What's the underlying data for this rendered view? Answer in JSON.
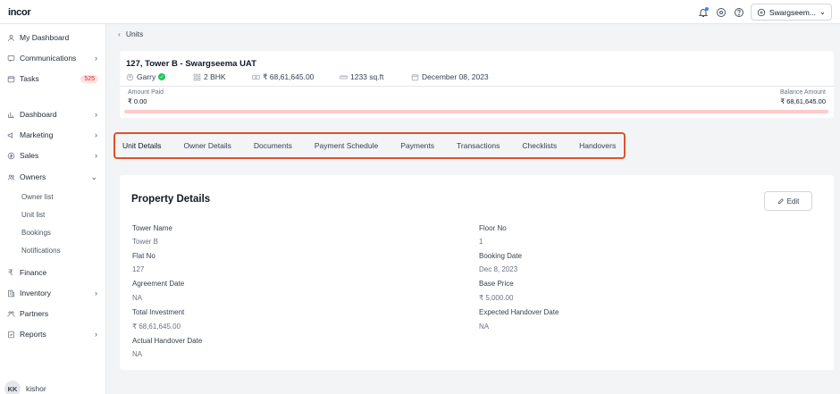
{
  "topbar": {
    "logo": "incor",
    "project": "Swargseem..."
  },
  "sidebar": {
    "items": [
      {
        "label": "My Dashboard",
        "icon": "user-icon"
      },
      {
        "label": "Communications",
        "icon": "chat-icon",
        "chevron": "›"
      },
      {
        "label": "Tasks",
        "icon": "calendar-icon",
        "badge": "525"
      },
      {
        "label": "Dashboard",
        "icon": "chart-icon",
        "chevron": "›"
      },
      {
        "label": "Marketing",
        "icon": "megaphone-icon",
        "chevron": "›"
      },
      {
        "label": "Sales",
        "icon": "dollar-icon",
        "chevron": "›"
      },
      {
        "label": "Owners",
        "icon": "users-icon",
        "chevron": "⌄"
      },
      {
        "label": "Finance",
        "icon": "rupee-icon"
      },
      {
        "label": "Inventory",
        "icon": "building-icon",
        "chevron": "›"
      },
      {
        "label": "Partners",
        "icon": "partners-icon"
      },
      {
        "label": "Reports",
        "icon": "report-icon",
        "chevron": "›"
      }
    ],
    "sub_items": [
      "Owner list",
      "Unit list",
      "Bookings",
      "Notifications"
    ],
    "user": {
      "initials": "KK",
      "name": "kishor"
    }
  },
  "breadcrumb": {
    "label": "Units"
  },
  "unit": {
    "title": "127, Tower B - Swargseema UAT",
    "owner": "Garry",
    "config": "2 BHK",
    "price": "₹ 68,61,645.00",
    "area": "1233 sq.ft",
    "date": "December 08, 2023",
    "amount_paid_label": "Amount Paid",
    "amount_paid": "₹ 0.00",
    "balance_label": "Balance Amount",
    "balance": "₹ 68,61,645.00",
    "paid_fraction": 0.0
  },
  "tabs": [
    "Unit Details",
    "Owner Details",
    "Documents",
    "Payment Schedule",
    "Payments",
    "Transactions",
    "Checklists",
    "Handovers"
  ],
  "details": {
    "title": "Property Details",
    "edit_label": "Edit",
    "left": [
      {
        "label": "Tower Name",
        "value": "Tower B"
      },
      {
        "label": "Flat No",
        "value": "127"
      },
      {
        "label": "Agreement Date",
        "value": "NA"
      },
      {
        "label": "Total Investment",
        "value": "₹ 68,61,645.00"
      },
      {
        "label": "Actual Handover Date",
        "value": "NA"
      }
    ],
    "right": [
      {
        "label": "Floor No",
        "value": "1"
      },
      {
        "label": "Booking Date",
        "value": "Dec 8, 2023"
      },
      {
        "label": "Base Price",
        "value": "₹ 5,000.00"
      },
      {
        "label": "Expected Handover Date",
        "value": "NA"
      }
    ]
  },
  "colors": {
    "highlight": "#e0522d",
    "progress_track": "#fecaca",
    "badge_text": "#dc2626",
    "verified": "#22c55e"
  }
}
